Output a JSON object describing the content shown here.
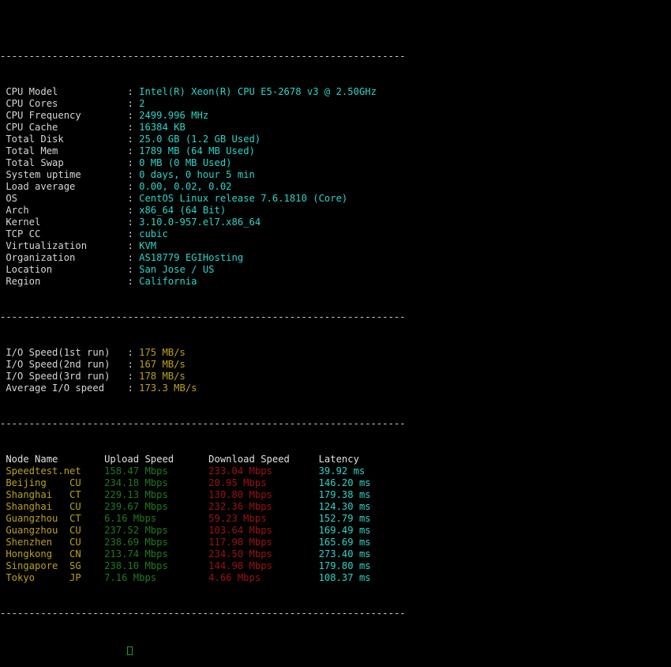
{
  "terminal": {
    "separator": "----------------------------------------------------------------------",
    "label_width": 21,
    "colon": ": ",
    "sysinfo": [
      {
        "label": "CPU Model",
        "value": "Intel(R) Xeon(R) CPU E5-2678 v3 @ 2.50GHz"
      },
      {
        "label": "CPU Cores",
        "value": "2"
      },
      {
        "label": "CPU Frequency",
        "value": "2499.996 MHz"
      },
      {
        "label": "CPU Cache",
        "value": "16384 KB"
      },
      {
        "label": "Total Disk",
        "value": "25.0 GB (1.2 GB Used)"
      },
      {
        "label": "Total Mem",
        "value": "1789 MB (64 MB Used)"
      },
      {
        "label": "Total Swap",
        "value": "0 MB (0 MB Used)"
      },
      {
        "label": "System uptime",
        "value": "0 days, 0 hour 5 min"
      },
      {
        "label": "Load average",
        "value": "0.00, 0.02, 0.02"
      },
      {
        "label": "OS",
        "value": "CentOS Linux release 7.6.1810 (Core)"
      },
      {
        "label": "Arch",
        "value": "x86_64 (64 Bit)"
      },
      {
        "label": "Kernel",
        "value": "3.10.0-957.el7.x86_64"
      },
      {
        "label": "TCP CC",
        "value": "cubic"
      },
      {
        "label": "Virtualization",
        "value": "KVM"
      },
      {
        "label": "Organization",
        "value": "AS18779 EGIHosting"
      },
      {
        "label": "Location",
        "value": "San Jose / US"
      },
      {
        "label": "Region",
        "value": "California"
      }
    ],
    "iospeed": [
      {
        "label": "I/O Speed(1st run)",
        "value": "175 MB/s"
      },
      {
        "label": "I/O Speed(2nd run)",
        "value": "167 MB/s"
      },
      {
        "label": "I/O Speed(3rd run)",
        "value": "178 MB/s"
      },
      {
        "label": "Average I/O speed",
        "value": "173.3 MB/s"
      }
    ],
    "speedtest": {
      "headers": {
        "node": "Node Name",
        "upload": "Upload Speed",
        "download": "Download Speed",
        "latency": "Latency"
      },
      "columns": {
        "node": 17,
        "upload": 18,
        "download": 19
      },
      "rows": [
        {
          "node": "Speedtest.net",
          "isp": "",
          "upload": "158.47 Mbps",
          "download": "233.04 Mbps",
          "latency": "39.92 ms"
        },
        {
          "node": "Beijing",
          "isp": "CU",
          "upload": "234.18 Mbps",
          "download": "20.95 Mbps",
          "latency": "146.20 ms"
        },
        {
          "node": "Shanghai",
          "isp": "CT",
          "upload": "229.13 Mbps",
          "download": "130.80 Mbps",
          "latency": "179.38 ms"
        },
        {
          "node": "Shanghai",
          "isp": "CU",
          "upload": "239.67 Mbps",
          "download": "232.36 Mbps",
          "latency": "124.30 ms"
        },
        {
          "node": "Guangzhou",
          "isp": "CT",
          "upload": "6.16 Mbps",
          "download": "59.23 Mbps",
          "latency": "152.79 ms"
        },
        {
          "node": "Guangzhou",
          "isp": "CU",
          "upload": "237.52 Mbps",
          "download": "103.64 Mbps",
          "latency": "169.49 ms"
        },
        {
          "node": "Shenzhen",
          "isp": "CU",
          "upload": "238.69 Mbps",
          "download": "117.98 Mbps",
          "latency": "165.69 ms"
        },
        {
          "node": "Hongkong",
          "isp": "CN",
          "upload": "213.74 Mbps",
          "download": "234.50 Mbps",
          "latency": "273.40 ms"
        },
        {
          "node": "Singapore",
          "isp": "SG",
          "upload": "238.10 Mbps",
          "download": "144.98 Mbps",
          "latency": "179.80 ms"
        },
        {
          "node": "Tokyo",
          "isp": "JP",
          "upload": "7.16 Mbps",
          "download": "4.66 Mbps",
          "latency": "108.37 ms"
        }
      ]
    }
  },
  "colors": {
    "background": "#000000",
    "label": "#d6d6d6",
    "value_cyan": "#2ad4c8",
    "io_yellow": "#b9a11a",
    "node_yellow": "#b9a11a",
    "upload_green": "#1f7a1f",
    "download_red": "#9e1212",
    "latency_cyan": "#2ad4c8",
    "separator": "#d6d6d6",
    "cursor": "#1f9c1f"
  }
}
